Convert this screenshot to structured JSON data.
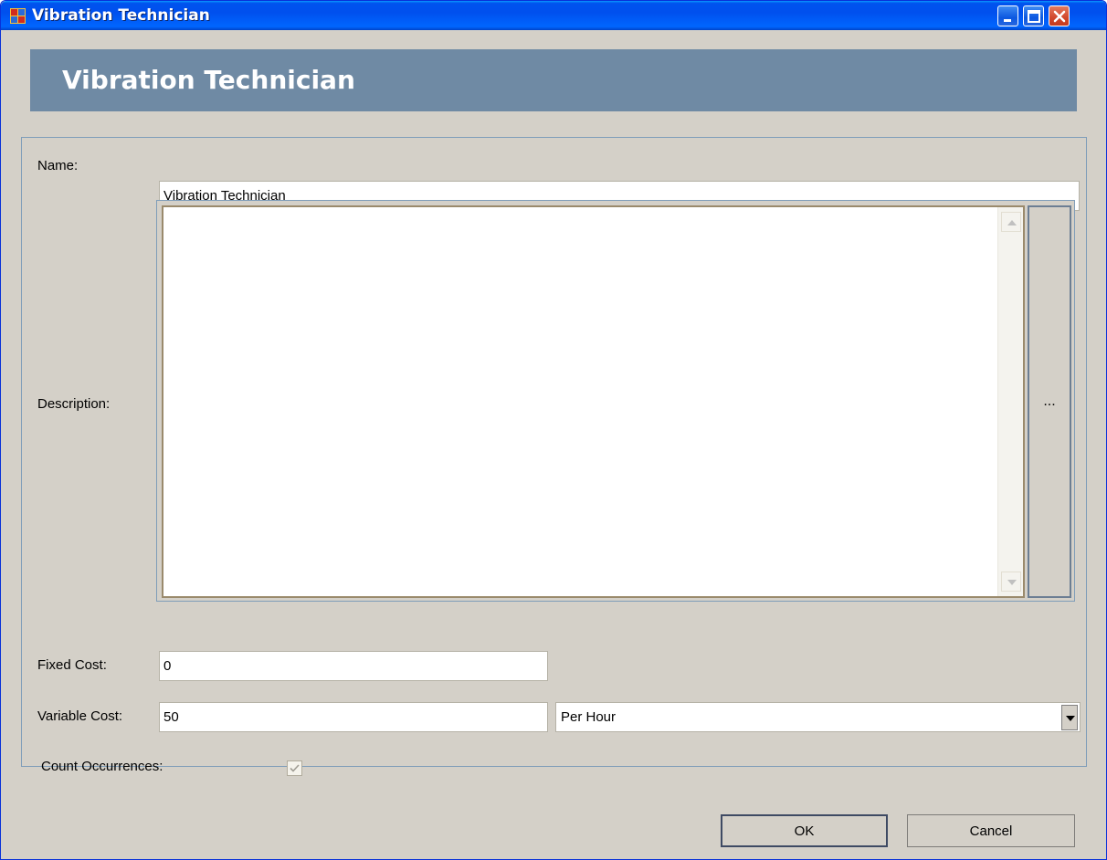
{
  "window": {
    "title": "Vibration Technician",
    "controls": {
      "minimize_icon": "minimize-icon",
      "maximize_icon": "maximize-icon",
      "close_icon": "close-icon"
    }
  },
  "header": {
    "title": "Vibration Technician"
  },
  "form": {
    "name_label": "Name:",
    "name_value": "Vibration Technician",
    "description_label": "Description:",
    "description_value": "",
    "description_ellipsis_label": "...",
    "fixed_cost_label": "Fixed Cost:",
    "fixed_cost_value": "0",
    "variable_cost_label": "Variable Cost:",
    "variable_cost_value": "50",
    "variable_cost_unit": "Per Hour",
    "count_occurrences_label": "Count Occurrences:",
    "count_occurrences_checked": true
  },
  "buttons": {
    "ok_label": "OK",
    "cancel_label": "Cancel"
  },
  "colors": {
    "titlebar": "#0054e3",
    "header_banner": "#6f8aa4",
    "dialog_background": "#d4d0c8"
  }
}
